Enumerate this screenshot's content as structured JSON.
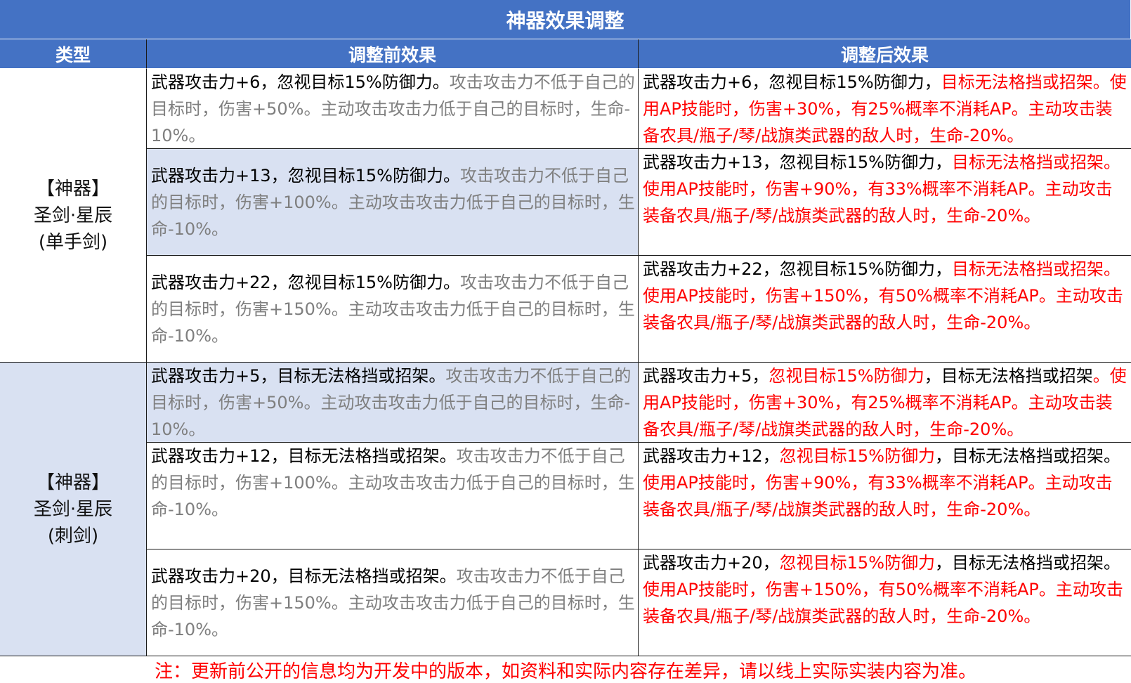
{
  "table": {
    "title": "神器效果调整",
    "headers": {
      "type": "类型",
      "before": "调整前效果",
      "after": "调整后效果"
    },
    "groups": [
      {
        "type_lines": [
          "【神器】",
          "圣剑·星辰",
          "(单手剑)"
        ],
        "rows": [
          {
            "before": [
              {
                "t": "武器攻击力+6，忽视目标15%防御力。",
                "c": "k"
              },
              {
                "t": "攻击攻击力不低于自己的目标时，伤害+50%。主动攻击攻击力低于自己的目标时，生命-10%。",
                "c": "g"
              }
            ],
            "after": [
              {
                "t": "武器攻击力+6，忽视目标15%防御力，",
                "c": "k"
              },
              {
                "t": "目标无法格挡或招架。使用AP技能时，伤害+30%，有25%概率不消耗AP。主动攻击装备农具/瓶子/琴/战旗类武器的敌人时，生命-20%。",
                "c": "r"
              }
            ]
          },
          {
            "before": [
              {
                "t": "武器攻击力+13，忽视目标15%防御力。",
                "c": "k"
              },
              {
                "t": "攻击攻击力不低于自己的目标时，伤害+100%。主动攻击攻击力低于自己的目标时，生命-10%。",
                "c": "g"
              }
            ],
            "after": [
              {
                "t": "武器攻击力+13，忽视目标15%防御力，",
                "c": "k"
              },
              {
                "t": "目标无法格挡或招架。使用AP技能时，伤害+90%，有33%概率不消耗AP。主动攻击装备农具/瓶子/琴/战旗类武器的敌人时，生命-20%。",
                "c": "r"
              }
            ]
          },
          {
            "before": [
              {
                "t": "武器攻击力+22，忽视目标15%防御力。",
                "c": "k"
              },
              {
                "t": "攻击攻击力不低于自己的目标时，伤害+150%。主动攻击攻击力低于自己的目标时，生命-10%。",
                "c": "g"
              }
            ],
            "after": [
              {
                "t": "武器攻击力+22，忽视目标15%防御力，",
                "c": "k"
              },
              {
                "t": "目标无法格挡或招架。使用AP技能时，伤害+150%，有50%概率不消耗AP。主动攻击装备农具/瓶子/琴/战旗类武器的敌人时，生命-20%。",
                "c": "r"
              }
            ]
          }
        ]
      },
      {
        "type_lines": [
          "【神器】",
          "圣剑·星辰",
          "(刺剑)"
        ],
        "rows": [
          {
            "before": [
              {
                "t": "武器攻击力+5，目标无法格挡或招架。",
                "c": "k"
              },
              {
                "t": "攻击攻击力不低于自己的目标时，伤害+50%。主动攻击攻击力低于自己的目标时，生命-10%。",
                "c": "g"
              }
            ],
            "after": [
              {
                "t": "武器攻击力+5，",
                "c": "k"
              },
              {
                "t": "忽视目标15%防御力",
                "c": "r"
              },
              {
                "t": "，目标无法格挡或招架",
                "c": "k"
              },
              {
                "t": "。使用AP技能时，伤害+30%，有25%概率不消耗AP。主动攻击装备农具/瓶子/琴/战旗类武器的敌人时，生命-20%。",
                "c": "r"
              }
            ]
          },
          {
            "before": [
              {
                "t": "武器攻击力+12，目标无法格挡或招架。",
                "c": "k"
              },
              {
                "t": "攻击攻击力不低于自己的目标时，伤害+100%。主动攻击攻击力低于自己的目标时，生命-10%。",
                "c": "g"
              }
            ],
            "after": [
              {
                "t": "武器攻击力+12，",
                "c": "k"
              },
              {
                "t": "忽视目标15%防御力",
                "c": "r"
              },
              {
                "t": "，目标无法格挡或招架。",
                "c": "k"
              },
              {
                "t": "使用AP技能时，伤害+90%，有33%概率不消耗AP。主动攻击装备农具/瓶子/琴/战旗类武器的敌人时，生命-20%。",
                "c": "r"
              }
            ]
          },
          {
            "before": [
              {
                "t": "武器攻击力+20，目标无法格挡或招架。",
                "c": "k"
              },
              {
                "t": "攻击攻击力不低于自己的目标时，伤害+150%。主动攻击攻击力低于自己的目标时，生命-10%。",
                "c": "g"
              }
            ],
            "after": [
              {
                "t": "武器攻击力+20，",
                "c": "k"
              },
              {
                "t": "忽视目标15%防御力",
                "c": "r"
              },
              {
                "t": "，目标无法格挡或招架。",
                "c": "k"
              },
              {
                "t": "使用AP技能时，伤害+150%，有50%概率不消耗AP。主动攻击装备农具/瓶子/琴/战旗类武器的敌人时，生命-20%。",
                "c": "r"
              }
            ]
          }
        ]
      }
    ],
    "footnote": "注：更新前公开的信息均为开发中的版本，如资料和实际内容存在差异，请以线上实际实装内容为准。"
  },
  "colors": {
    "header_bg": "#4472c4",
    "band_bg": "#d9e1f2",
    "gray_text": "#7f7f7f",
    "red_text": "#ff0000"
  }
}
